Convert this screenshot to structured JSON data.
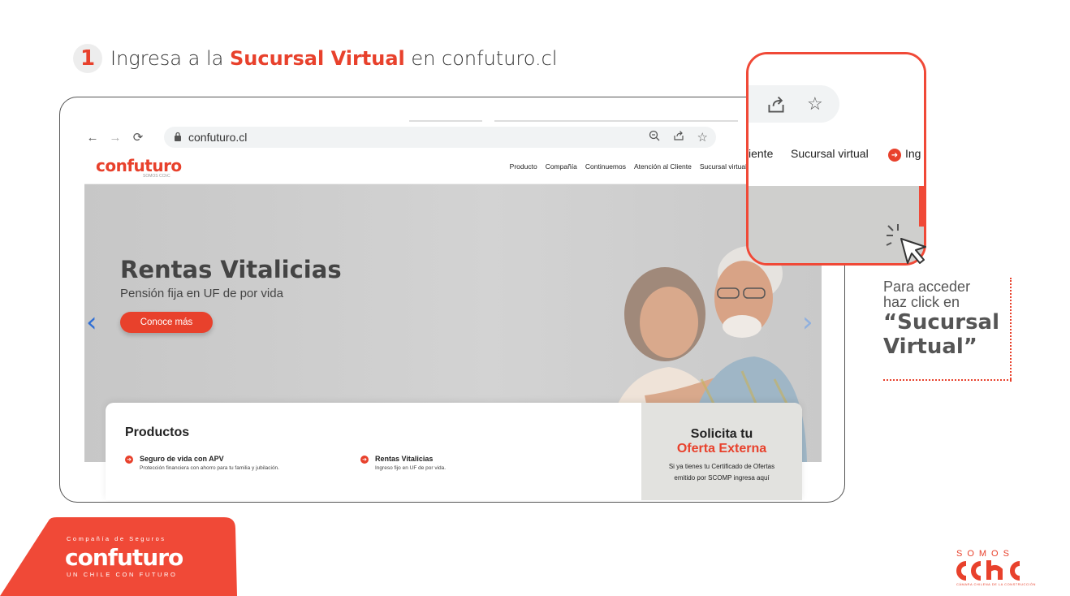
{
  "step": {
    "number": "1",
    "prefix": "Ingresa a la",
    "highlight": "Sucursal Virtual",
    "suffix": "en confuturo.cl"
  },
  "browser": {
    "back_icon": "arrow-left-icon",
    "forward_icon": "arrow-right-icon",
    "reload_icon": "reload-icon",
    "lock_icon": "lock-icon",
    "url": "confuturo.cl",
    "zoom_icon": "zoom-icon",
    "share_icon": "share-icon",
    "star_icon": "star-icon"
  },
  "site": {
    "logo": "confuturo",
    "logo_sub": "SOMOS CChC",
    "menu": [
      "Producto",
      "Compañía",
      "Continuemos",
      "Atención al Cliente",
      "Sucursal virtual"
    ]
  },
  "hero": {
    "title": "Rentas Vitalicias",
    "subtitle": "Pensión fija en UF de por vida",
    "button": "Conoce más"
  },
  "products": {
    "title": "Productos",
    "items": [
      {
        "name": "Seguro de vida con APV",
        "desc": "Protección financiera con ahorro para tu familia y jubilación."
      },
      {
        "name": "Rentas Vitalicias",
        "desc": "Ingreso fijo en UF de por vida."
      }
    ],
    "offer": {
      "line1": "Solicita tu",
      "line2": "Oferta Externa",
      "line3": "Si ya tienes tu Certificado de Ofertas",
      "line4": "emitido por SCOMP ingresa aquí"
    }
  },
  "zoom": {
    "menu_partial": "iente",
    "menu_item": "Sucursal virtual",
    "menu_next": "Ing"
  },
  "note": {
    "line1": "Para acceder",
    "line2": "haz click en",
    "line3": "“Sucursal",
    "line4": "Virtual”"
  },
  "footer": {
    "company_small": "Compañía de Seguros",
    "brand": "confuturo",
    "tagline": "UN CHILE CON FUTURO",
    "somos": "SOMOS",
    "cchc_sub": "CÁMARA CHILENA DE LA CONSTRUCCIÓN"
  },
  "colors": {
    "accent": "#e8412c",
    "hero_bg": "#cbcbcb"
  }
}
